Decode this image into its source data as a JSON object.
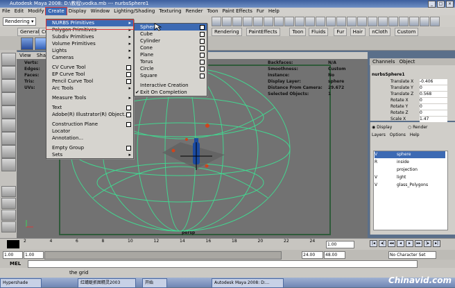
{
  "window": {
    "title": "Autodesk Maya 2008: D:\\教程\\vodka.mb --- nurbsSphere1"
  },
  "menubar": [
    "File",
    "Edit",
    "Modify",
    "Create",
    "Display",
    "Window",
    "Lighting/Shading",
    "Texturing",
    "Render",
    "Toon",
    "Paint Effects",
    "Fur",
    "Help"
  ],
  "status": {
    "mode_dropdown": "Rendering"
  },
  "shelf_tabs_left": [
    "General",
    "Cu"
  ],
  "shelf_tabs_right": [
    "Rendering",
    "PaintEffects",
    "Toon",
    "Fluids",
    "Fur",
    "Hair",
    "nCloth",
    "Custom"
  ],
  "viewport": {
    "menu": [
      "View",
      "Shad"
    ],
    "hud_left": [
      "Verts:",
      "Edges:",
      "Faces:",
      "Tris:",
      "UVs:"
    ],
    "hud_right_labels": [
      "Backfaces:",
      "Smoothness:",
      "Instance:",
      "Display Layer:",
      "Distance From Camera:",
      "Selected Objects:"
    ],
    "hud_right_values": [
      "N/A",
      "Custom",
      "No",
      "sphere",
      "29.672",
      "1"
    ],
    "camera_label": "persp"
  },
  "create_menu": {
    "items": [
      {
        "label": "NURBS Primitives",
        "arrow": true,
        "hl": true
      },
      {
        "label": "Polygon Primitives",
        "arrow": true
      },
      {
        "label": "Subdiv Primitives",
        "arrow": true
      },
      {
        "label": "Volume Primitives",
        "arrow": true
      },
      {
        "label": "Lights",
        "arrow": true
      },
      {
        "label": "Cameras",
        "arrow": true
      },
      {
        "sep": true
      },
      {
        "label": "CV Curve Tool",
        "box": true
      },
      {
        "label": "EP Curve Tool",
        "box": true
      },
      {
        "label": "Pencil Curve Tool",
        "box": true
      },
      {
        "label": "Arc Tools",
        "arrow": true
      },
      {
        "sep": true
      },
      {
        "label": "Measure Tools",
        "arrow": true
      },
      {
        "sep": true
      },
      {
        "label": "Text",
        "box": true
      },
      {
        "label": "Adobe(R) Illustrator(R) Object...",
        "box": true
      },
      {
        "sep": true
      },
      {
        "label": "Construction Plane",
        "box": true
      },
      {
        "label": "Locator"
      },
      {
        "label": "Annotation..."
      },
      {
        "sep": true
      },
      {
        "label": "Empty Group",
        "box": true
      },
      {
        "label": "Sets",
        "arrow": true
      }
    ]
  },
  "nurbs_submenu": {
    "items": [
      {
        "label": "Sphere",
        "box": true,
        "hl": true
      },
      {
        "label": "Cube",
        "box": true
      },
      {
        "label": "Cylinder",
        "box": true
      },
      {
        "label": "Cone",
        "box": true
      },
      {
        "label": "Plane",
        "box": true
      },
      {
        "label": "Torus",
        "box": true
      },
      {
        "label": "Circle",
        "box": true
      },
      {
        "label": "Square",
        "box": true
      },
      {
        "sep": true
      },
      {
        "label": "Interactive Creation"
      },
      {
        "label": "Exit On Completion",
        "check": true
      }
    ]
  },
  "channel_box": {
    "tabs": [
      "Channels",
      "Object"
    ],
    "object": "nurbsSphere1",
    "channels": [
      {
        "name": "Translate X",
        "value": "-0.406"
      },
      {
        "name": "Translate Y",
        "value": "0"
      },
      {
        "name": "Translate Z",
        "value": "0.568"
      },
      {
        "name": "Rotate X",
        "value": "0"
      },
      {
        "name": "Rotate Y",
        "value": "0"
      },
      {
        "name": "Rotate Z",
        "value": "0"
      },
      {
        "name": "Scale X",
        "value": "1.47"
      }
    ]
  },
  "layer_editor": {
    "radio": [
      "Display",
      "Render"
    ],
    "menu": [
      "Layers",
      "Options",
      "Help"
    ],
    "layers": [
      {
        "v": "V",
        "name": "sphere",
        "selected": true
      },
      {
        "v": "R",
        "name": "inside"
      },
      {
        "v": "",
        "name": "projection"
      },
      {
        "v": "V",
        "name": "light"
      },
      {
        "v": "V",
        "name": "glass_Polygons"
      }
    ]
  },
  "timeline": {
    "ticks": [
      "2",
      "4",
      "6",
      "8",
      "10",
      "12",
      "14",
      "16",
      "18",
      "20",
      "22",
      "24"
    ],
    "current": "1.00",
    "range_start": "1.00",
    "range_s2": "1.00",
    "range_end": "24.00",
    "range_e2": "48.00",
    "character_set": "No Character Set"
  },
  "mel": {
    "label": "MEL"
  },
  "help_line": "the grid",
  "taskbar": [
    "Hypershade",
    "开始",
    "红蜻蜓抓图精灵2003",
    "Autodesk Maya 2008: D:..."
  ],
  "watermark": "Chinavid.com"
}
